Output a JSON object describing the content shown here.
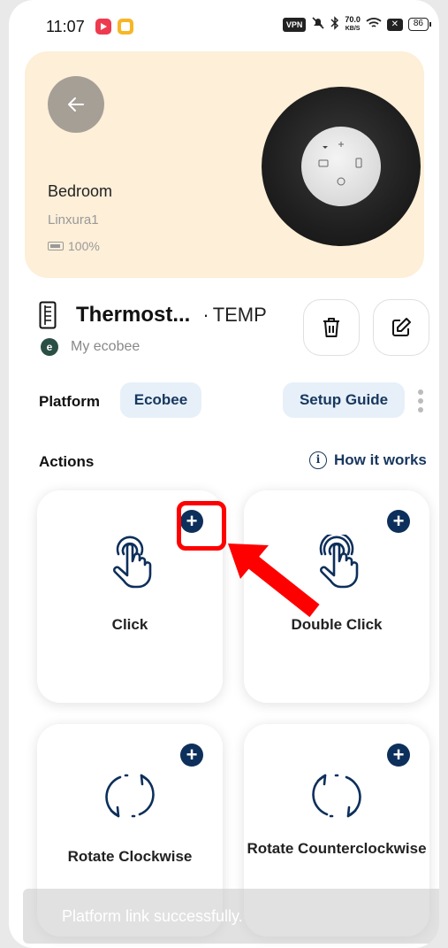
{
  "status_bar": {
    "time": "11:07",
    "vpn": "VPN",
    "speed_value": "70.0",
    "speed_unit": "KB/S",
    "battery": "86"
  },
  "device": {
    "room": "Bedroom",
    "name": "Linxura1",
    "battery": "100%"
  },
  "header": {
    "title": "Thermost...",
    "separator": "·",
    "type": "TEMP",
    "account_logo": "e",
    "account": "My ecobee"
  },
  "platform": {
    "label": "Platform",
    "value": "Ecobee",
    "guide_label": "Setup Guide"
  },
  "actions": {
    "label": "Actions",
    "how_it_works": "How it works",
    "info_glyph": "i",
    "items": [
      {
        "label": "Click",
        "icon": "tap-icon"
      },
      {
        "label": "Double Click",
        "icon": "double-tap-icon"
      },
      {
        "label": "Rotate Clockwise",
        "icon": "rotate-clockwise-icon"
      },
      {
        "label": "Rotate Counterclockwise",
        "icon": "rotate-counterclockwise-icon"
      }
    ],
    "add_glyph": "+"
  },
  "toast": {
    "message": "Platform link successfully."
  },
  "colors": {
    "accent": "#0d2f5b",
    "chip_bg": "#e7f0f9",
    "card_bg": "#fdefd8",
    "highlight": "#ff0000"
  }
}
